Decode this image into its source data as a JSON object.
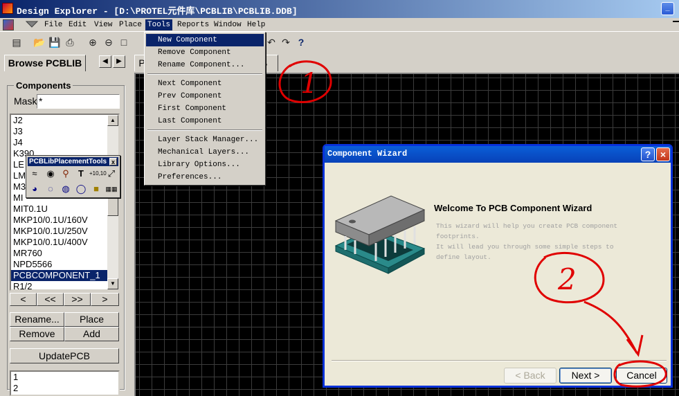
{
  "window": {
    "title": "Design Explorer - [D:\\PROTEL元件库\\PCBLIB\\PCBLIB.DDB]",
    "minimize_label": "_"
  },
  "menubar": {
    "items": [
      "File",
      "Edit",
      "View",
      "Place",
      "Tools",
      "Reports",
      "Window",
      "Help"
    ],
    "open_menu": "Tools"
  },
  "tools_menu": {
    "items": [
      "New Component",
      "Remove Component",
      "Rename Component...",
      "Next Component",
      "Prev Component",
      "First Component",
      "Last Component",
      "Layer Stack Manager...",
      "Mechanical Layers...",
      "Library Options...",
      "Preferences..."
    ],
    "highlighted": "New Component"
  },
  "browse_panel": {
    "tab_label": "Browse PCBLIB",
    "components_label": "Components",
    "mask_label": "Mask",
    "mask_value": "*",
    "components": [
      "J2",
      "J3",
      "J4",
      "K390",
      "LE",
      "LM",
      "M3",
      "MI",
      "MIT0.1U",
      "MKP10/0.1U/160V",
      "MKP10/0.1U/250V",
      "MKP10/0.1U/400V",
      "MR760",
      "NPD5566",
      "PCBCOMPONENT_1",
      "R1/2"
    ],
    "selected_component": "PCBCOMPONENT_1",
    "nav_buttons": [
      "<",
      "<<",
      ">>",
      ">"
    ],
    "rename_label": "Rename...",
    "place_label": "Place",
    "remove_label": "Remove",
    "add_label": "Add",
    "update_label": "UpdatePCB",
    "pins": [
      "1",
      "2"
    ]
  },
  "floating_toolbar": {
    "title": "PCBLibPlacementTools",
    "close_label": "x"
  },
  "doc_tabs": {
    "tab1": "P",
    "tab2": "B"
  },
  "wizard": {
    "title": "Component Wizard",
    "help_label": "?",
    "close_label": "×",
    "heading": "Welcome To PCB Component Wizard",
    "description_lines": [
      "This wizard will help you create PCB component",
      "footprints.",
      "It will lead you through some simple steps to",
      "define layout."
    ],
    "back_label": "< Back",
    "next_label": "Next >",
    "cancel_label": "Cancel"
  },
  "annotations": {
    "circle1_text": "1",
    "circle2_text": "2",
    "color": "#e00000"
  }
}
